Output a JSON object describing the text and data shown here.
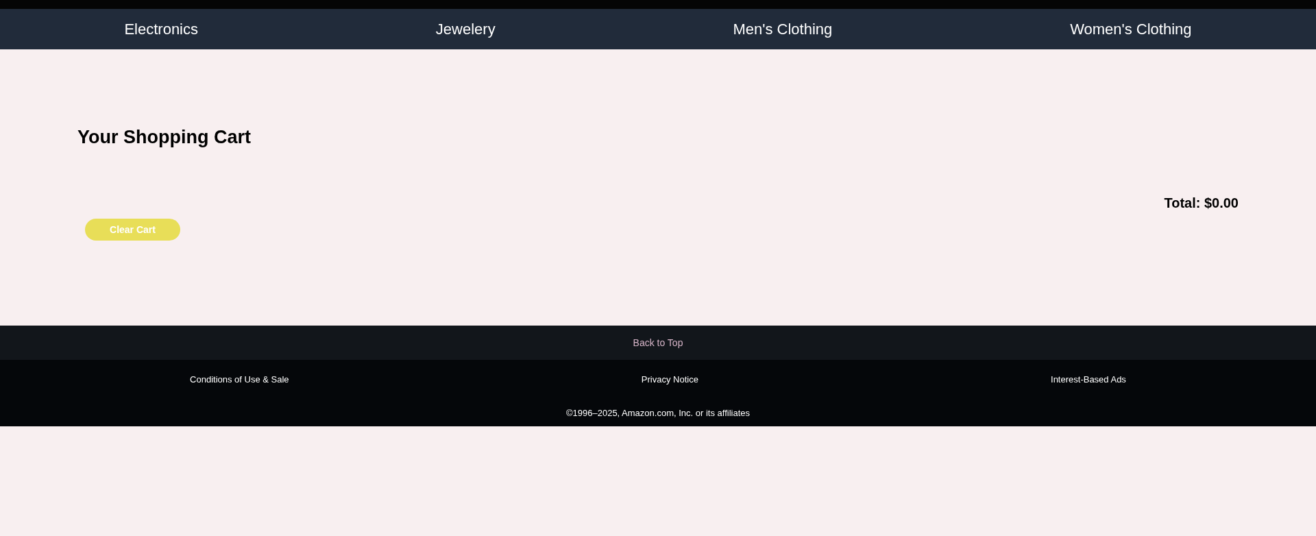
{
  "nav": {
    "items": [
      "Electronics",
      "Jewelery",
      "Men's Clothing",
      "Women's Clothing"
    ]
  },
  "cart": {
    "title": "Your Shopping Cart",
    "total": "Total: $0.00",
    "clear_button": "Clear Cart"
  },
  "footer": {
    "back_to_top": "Back to Top",
    "links": [
      "Conditions of Use & Sale",
      "Privacy Notice",
      "Interest-Based Ads"
    ],
    "copyright": "©1996–2025, Amazon.com, Inc. or its affiliates"
  }
}
